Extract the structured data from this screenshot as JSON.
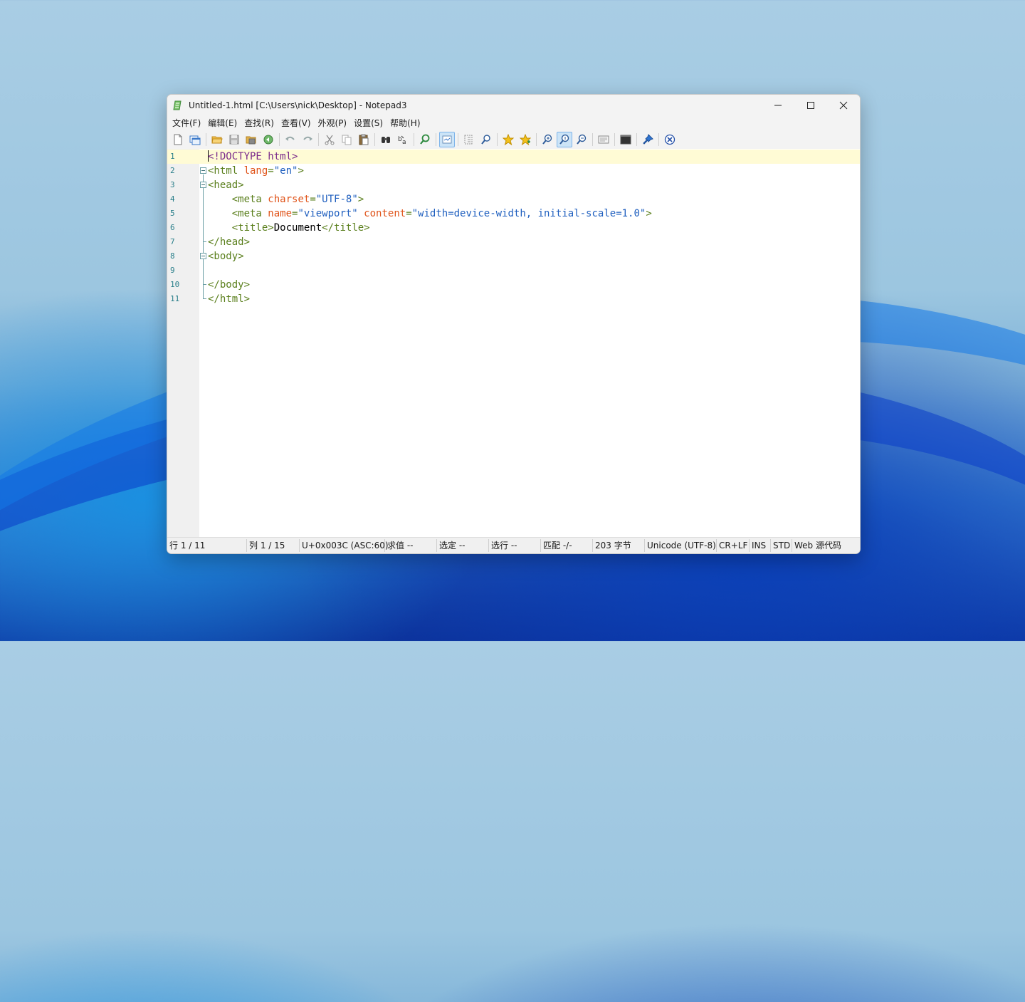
{
  "window": {
    "title": "Untitled-1.html [C:\\Users\\nick\\Desktop] - Notepad3",
    "minimize_icon": "minimize-icon",
    "maximize_icon": "maximize-icon",
    "close_icon": "close-icon"
  },
  "menu": [
    "文件(F)",
    "编辑(E)",
    "查找(R)",
    "查看(V)",
    "外观(P)",
    "设置(S)",
    "帮助(H)"
  ],
  "toolbar": {
    "icons": [
      "new-file-icon",
      "new-window-icon",
      "open-icon",
      "save-icon",
      "save-as-icon",
      "revert-icon",
      "undo-icon",
      "redo-icon",
      "cut-icon",
      "copy-icon",
      "paste-icon",
      "find-icon",
      "replace-icon",
      "goto-icon",
      "word-wrap-icon",
      "select-all-icon",
      "zoom-find-icon",
      "favorite-icon",
      "add-favorite-icon",
      "zoom-in-icon",
      "zoom-reset-icon",
      "zoom-out-icon",
      "page-setup-icon",
      "terminal-icon",
      "pin-icon",
      "exit-icon"
    ],
    "active": "word-wrap-icon"
  },
  "editor": {
    "current_line": 1,
    "lines": [
      {
        "n": "1",
        "tokens": [
          [
            "d",
            "<!DOCTYPE html>"
          ]
        ]
      },
      {
        "n": "2",
        "tokens": [
          [
            "t",
            "<html "
          ],
          [
            "a",
            "lang"
          ],
          [
            "t",
            "="
          ],
          [
            "v",
            "\"en\""
          ],
          [
            "t",
            ">"
          ]
        ]
      },
      {
        "n": "3",
        "tokens": [
          [
            "t",
            "<head>"
          ]
        ]
      },
      {
        "n": "4",
        "tokens": [
          [
            "txt",
            "    "
          ],
          [
            "t",
            "<meta "
          ],
          [
            "a",
            "charset"
          ],
          [
            "t",
            "="
          ],
          [
            "v",
            "\"UTF-8\""
          ],
          [
            "t",
            ">"
          ]
        ]
      },
      {
        "n": "5",
        "tokens": [
          [
            "txt",
            "    "
          ],
          [
            "t",
            "<meta "
          ],
          [
            "a",
            "name"
          ],
          [
            "t",
            "="
          ],
          [
            "v",
            "\"viewport\" "
          ],
          [
            "a",
            "content"
          ],
          [
            "t",
            "="
          ],
          [
            "v",
            "\"width=device-width, initial-scale=1.0\""
          ],
          [
            "t",
            ">"
          ]
        ]
      },
      {
        "n": "6",
        "tokens": [
          [
            "txt",
            "    "
          ],
          [
            "t",
            "<title>"
          ],
          [
            "txt",
            "Document"
          ],
          [
            "t",
            "</title>"
          ]
        ]
      },
      {
        "n": "7",
        "tokens": [
          [
            "t",
            "</head>"
          ]
        ]
      },
      {
        "n": "8",
        "tokens": [
          [
            "t",
            "<body>"
          ]
        ]
      },
      {
        "n": "9",
        "tokens": []
      },
      {
        "n": "10",
        "tokens": [
          [
            "t",
            "</body>"
          ]
        ]
      },
      {
        "n": "11",
        "tokens": [
          [
            "t",
            "</html>"
          ]
        ]
      }
    ]
  },
  "status": {
    "line": "行  1 / 11",
    "column": "列  1 / 15",
    "char": "U+0x003C (ASC:60)",
    "sum": "求值  --",
    "selected": "选定  --",
    "sel_lines": "选行  --",
    "match": "匹配  -/-",
    "bytes": "203 字节",
    "encoding": "Unicode (UTF-8)",
    "eol": "CR+LF",
    "ins": "INS",
    "std": "STD",
    "lexer": "Web 源代码"
  }
}
